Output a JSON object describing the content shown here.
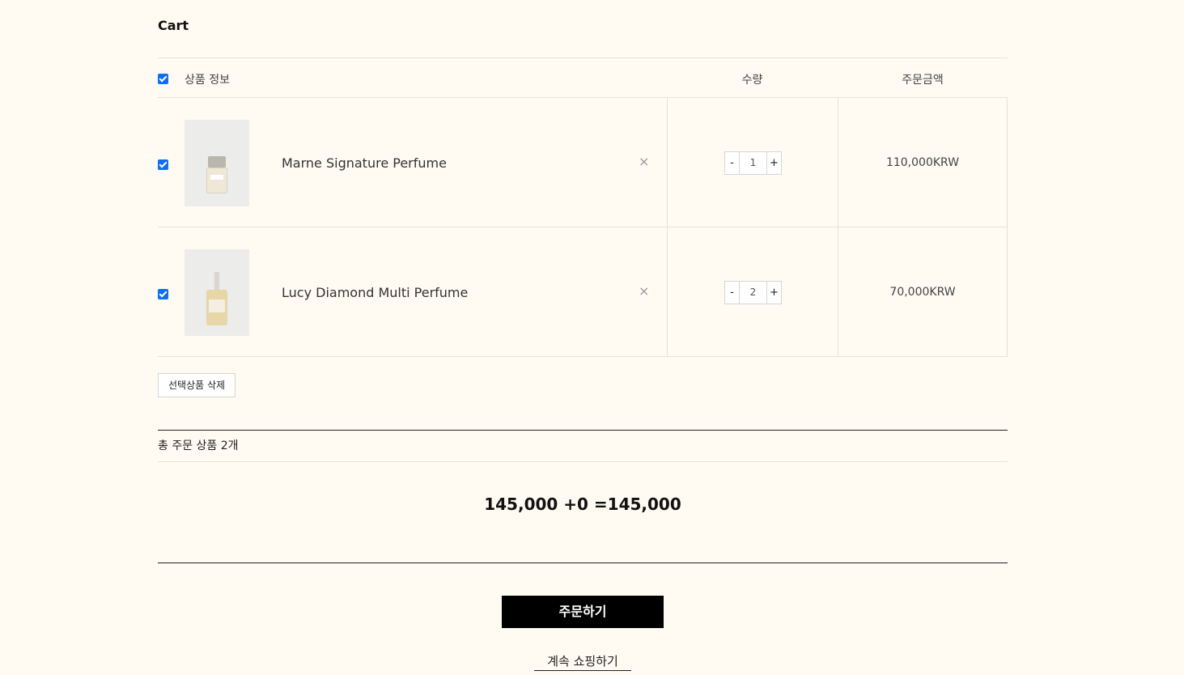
{
  "page": {
    "title": "Cart"
  },
  "table": {
    "headers": {
      "product_info": "상품 정보",
      "quantity": "수량",
      "order_amount": "주문금액"
    },
    "select_all_checked": true,
    "items": [
      {
        "name": "Marne Signature Perfume",
        "remove_label": "×",
        "quantity": "1",
        "minus": "-",
        "plus": "+",
        "price": "110,000KRW",
        "checked": true,
        "image_icon": "perfume-bottle-icon"
      },
      {
        "name": "Lucy Diamond Multi Perfume",
        "remove_label": "×",
        "quantity": "2",
        "minus": "-",
        "plus": "+",
        "price": "70,000KRW",
        "checked": true,
        "image_icon": "perfume-bottle-icon"
      }
    ]
  },
  "actions": {
    "delete_selected": "선택상품 삭제"
  },
  "summary": {
    "total_count_label": "총 주문 상품 2개",
    "total_formula": "145,000 +0 =145,000"
  },
  "footer": {
    "order_button": "주문하기",
    "continue_shopping": "계속 쇼핑하기"
  },
  "colors": {
    "background": "#fffbf3",
    "checkbox": "#0d6efd",
    "order_button_bg": "#000000"
  }
}
